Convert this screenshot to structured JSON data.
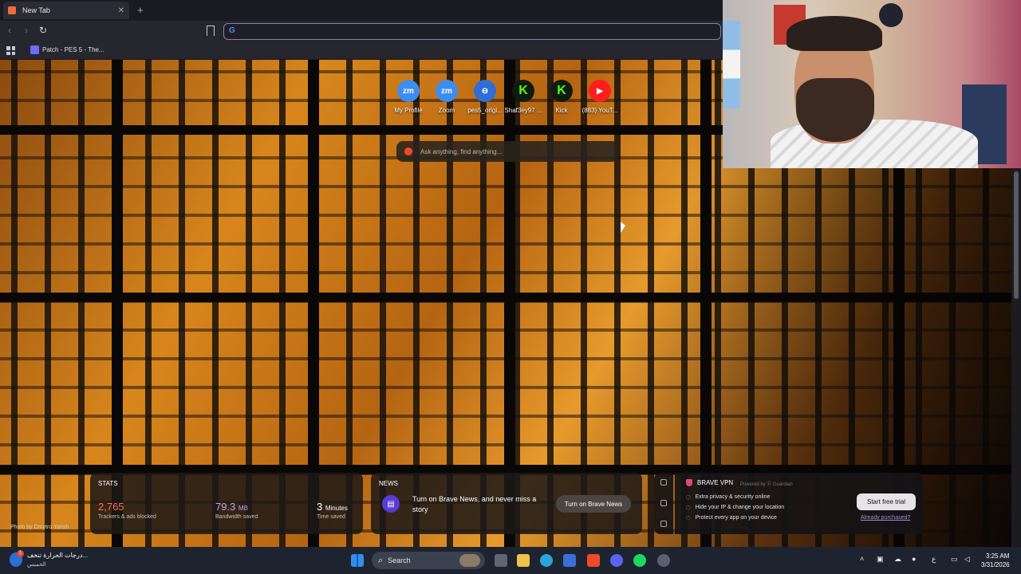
{
  "browser": {
    "tab_title": "New Tab",
    "tab_close": "✕",
    "new_tab": "+",
    "url_value": "",
    "bookmarks": [
      {
        "label": "Patch - PES 5 - The..."
      }
    ]
  },
  "newtab": {
    "top_sites": [
      {
        "label": "My Profile",
        "icon_text": "zm",
        "icon": "zoom-icon"
      },
      {
        "label": "Zoom",
        "icon_text": "zm",
        "icon": "zoom-icon"
      },
      {
        "label": "pes5_origi...",
        "icon_text": "⊖",
        "icon": "pes-icon"
      },
      {
        "label": "Shaf3ey97 ...",
        "icon_text": "K",
        "icon": "kick-icon"
      },
      {
        "label": "Kick",
        "icon_text": "K",
        "icon": "kick-icon"
      },
      {
        "label": "(883) YouT...",
        "icon_text": "▶",
        "icon": "youtube-icon"
      }
    ],
    "search_placeholder": "Ask anything, find anything...",
    "photo_credit": "Photo by Dmytro Yarish",
    "stats": {
      "header": "STATS",
      "trackers_value": "2,765",
      "trackers_label": "Trackers & ads blocked",
      "bandwidth_value": "79.3",
      "bandwidth_unit": "MB",
      "bandwidth_label": "Bandwidth saved",
      "time_value": "3",
      "time_unit": "Minutes",
      "time_label": "Time saved",
      "colors": {
        "trackers": "#ff6f52",
        "bandwidth": "#b7a3f0",
        "time": "#ffffff"
      }
    },
    "news": {
      "header": "NEWS",
      "text": "Turn on Brave News, and never miss a story",
      "button": "Turn on Brave News"
    },
    "vpn": {
      "title": "BRAVE VPN",
      "powered_by": "Powered by Ⓖ Guardian",
      "features": [
        "Extra privacy & security online",
        "Hide your IP & change your location",
        "Protect every app on your device"
      ],
      "trial_button": "Start free trial",
      "already_purchased": "Already purchased?"
    }
  },
  "taskbar": {
    "weather_line1": "درجات الحرارة تنخف...",
    "weather_line2": "الخميس",
    "weather_badge": "1",
    "search_label": "Search",
    "time": "3:25 AM",
    "date": "3/31/2026",
    "lang": "ع"
  }
}
